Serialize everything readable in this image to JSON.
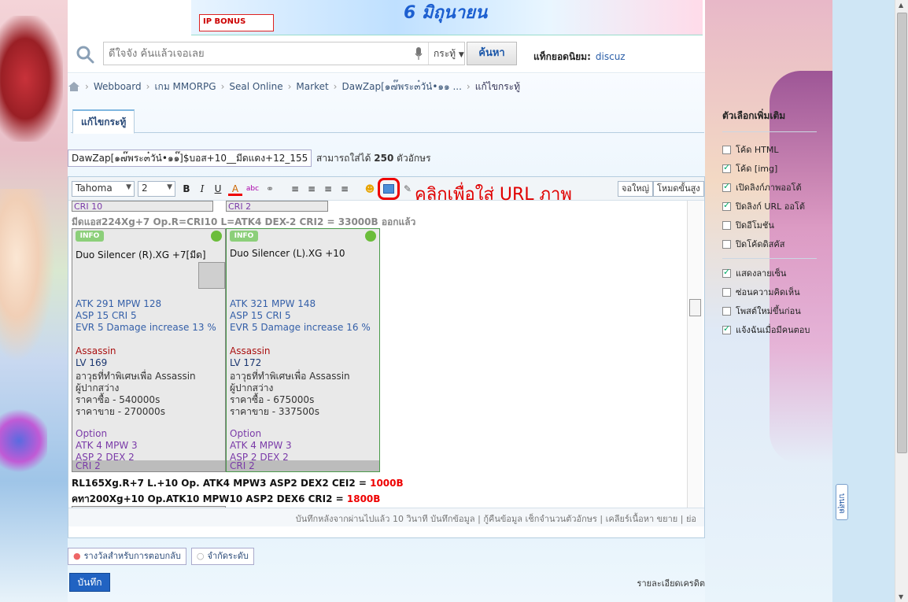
{
  "banner": {
    "bonus_text": "IP BONUS",
    "date_text": "6 มิถุนายน"
  },
  "search": {
    "placeholder": "ดีใจจัง ค้นแล้วเจอเลย",
    "scope": "กระทู้",
    "button": "ค้นหา",
    "popular_label": "แท็กยอดนิยม:",
    "popular_keyword": "discuz"
  },
  "breadcrumb": [
    "Webboard",
    "เกม MMORPG",
    "Seal Online",
    "Market",
    "DawZap[๑๗๊พระ๓๋วัน๋•๑๑ ...",
    "แก้ไขกระทู้"
  ],
  "tab": {
    "label": "แก้ไขกระทู้"
  },
  "subject": {
    "value": "DawZap[๑๗๊พระ๓๋วัน๋•๑๑๊]$บอส+10__มีดแดง+12_155+",
    "hint_prefix": "สามารถใส่ได้",
    "hint_count": "250",
    "hint_suffix": "ตัวอักษร"
  },
  "toolbar": {
    "font": "Tahoma",
    "size": "2",
    "bold": "B",
    "italic": "I",
    "underline": "U",
    "color": "A",
    "annotation": "คลิกเพื่อใส่ URL ภาพ",
    "fullscreen": "จอใหญ่",
    "advanced": "โหมดขั้นสูง"
  },
  "editor": {
    "top_cri_left": "CRI 10",
    "top_cri_right": "CRI 2",
    "line1": "มีดแอส224Xg+7 Op.R=CRI10  L=ATK4 DEX-2 CRI2 = 33000B ออกแล้ว",
    "cards": [
      {
        "name": "Duo Silencer (R).XG +7[มีด]",
        "stat1": "ATK 291     MPW 128",
        "stat2": "ASP 15     CRI 5",
        "stat3": "EVR 5      Damage increase 13 %",
        "class": "Assassin",
        "lv": "LV 169",
        "desc1": "อาวุธที่ทำพิเศษเพื่อ Assassin",
        "desc2": " ผู้ปากสว่าง",
        "buy": "ราคาซื้อ - 540000s",
        "sell": "ราคาขาย - 270000s",
        "option": "Option",
        "opt1": "ATK 4   MPW 3",
        "opt2": "ASP 2   DEX 2",
        "bottom": "CRI 2"
      },
      {
        "name": "Duo Silencer (L).XG +10",
        "stat1": "ATK 321     MPW 148",
        "stat2": "ASP 15     CRI 5",
        "stat3": "EVR 5      Damage increase 16 %",
        "class": "Assassin",
        "lv": "LV 172",
        "desc1": "อาวุธที่ทำพิเศษเพื่อ Assassin",
        "desc2": " ผู้ปากสว่าง",
        "buy": "ราคาซื้อ - 675000s",
        "sell": "ราคาขาย - 337500s",
        "option": "Option",
        "opt1": "ATK 4   MPW 3",
        "opt2": "ASP 2   DEX 2",
        "bottom": "CRI 2"
      }
    ],
    "line2_text": "RL165Xg.R+7 L.+10 Op. ATK4 MPW3 ASP2 DEX2 CEI2 = ",
    "line2_price": "1000B",
    "line3_text": "คทา200Xg+10 Op.ATK10 MPW10 ASP2 DEX6 CRI2 = ",
    "line3_price": "1800B"
  },
  "statusbar": "บันทึกหลังจากผ่านไปแล้ว 10 วินาที บันทึกข้อมูล | กู้คืนข้อมูล     เช็กจำนวนตัวอักษร | เคลียร์เนื้อหา     ขยาย | ย่อ",
  "rewards": {
    "reply_reward": "รางวัลสำหรับการตอบกลับ",
    "limit": "จำกัดระดับ"
  },
  "submit": "บันทึก",
  "credit": "รายละเอียดเครดิต",
  "options": {
    "title": "ตัวเลือกเพิ่มเติม",
    "items": [
      {
        "label": "โค้ด HTML",
        "checked": false
      },
      {
        "label": "โค้ด [img]",
        "checked": true
      },
      {
        "label": "เปิดลิงก์ภาพออโต้",
        "checked": true
      },
      {
        "label": "ปิดลิงก์ URL ออโต้",
        "checked": true
      },
      {
        "label": "ปิดอีโมชัน",
        "checked": false
      },
      {
        "label": "ปิดโค้ดดิสคัส",
        "checked": false
      }
    ],
    "items2": [
      {
        "label": "แสดงลายเซ็น",
        "checked": true
      },
      {
        "label": "ซ่อนความคิดเห็น",
        "checked": false
      },
      {
        "label": "โพสต์ใหม่ขึ้นก่อน",
        "checked": false
      },
      {
        "label": "แจ้งฉันเมื่อมีคนตอบ",
        "checked": true
      }
    ]
  },
  "side_tab": "บนสุด"
}
